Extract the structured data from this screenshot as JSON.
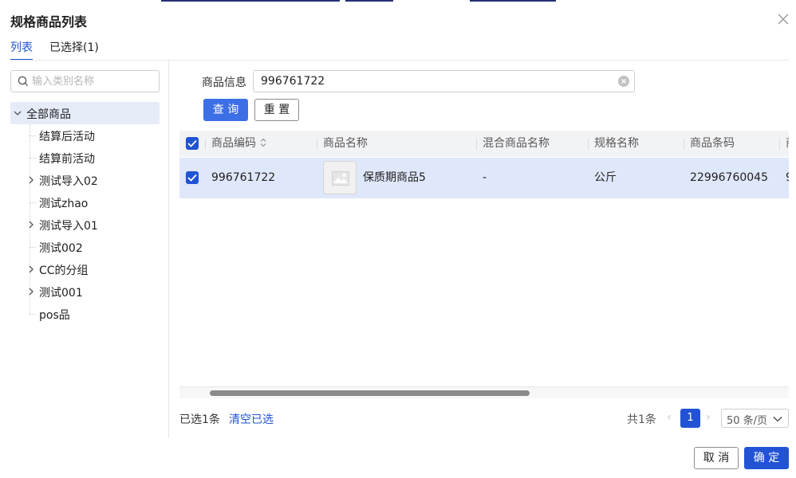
{
  "dialog": {
    "title": "规格商品列表",
    "tabs": [
      {
        "label": "列表",
        "active": true
      },
      {
        "label": "已选择(1)",
        "active": false
      }
    ]
  },
  "sidebar": {
    "search_placeholder": "输入类别名称",
    "root": {
      "label": "全部商品",
      "expanded": true
    },
    "items": [
      {
        "label": "结算后活动",
        "expandable": false
      },
      {
        "label": "结算前活动",
        "expandable": false
      },
      {
        "label": "测试导入02",
        "expandable": true
      },
      {
        "label": "测试zhao",
        "expandable": false
      },
      {
        "label": "测试导入01",
        "expandable": true
      },
      {
        "label": "测试002",
        "expandable": false
      },
      {
        "label": "CC的分组",
        "expandable": true
      },
      {
        "label": "测试001",
        "expandable": true
      },
      {
        "label": "pos品",
        "expandable": false
      }
    ]
  },
  "filter": {
    "label": "商品信息",
    "value": "996761722",
    "query_button": "查 询",
    "reset_button": "重 置"
  },
  "table": {
    "columns": [
      "商品编码",
      "商品名称",
      "混合商品名称",
      "规格名称",
      "商品条码",
      "商"
    ],
    "rows": [
      {
        "selected": true,
        "code": "996761722",
        "name": "保质期商品5",
        "mixed_name": "-",
        "spec_name": "公斤",
        "barcode": "22996760045",
        "overflow": "9"
      }
    ]
  },
  "footer": {
    "selected_text": "已选1条",
    "clear_link": "清空已选",
    "total": "共1条",
    "prev": "‹",
    "next": "›",
    "current_page": "1",
    "page_size": "50 条/页",
    "cancel_button": "取 消",
    "confirm_button": "确 定"
  },
  "colors": {
    "accent": "#2153d4",
    "primary_button": "#3c6fe6",
    "selected_row": "#dfe7fa",
    "selected_tree": "#e6ebf8"
  }
}
